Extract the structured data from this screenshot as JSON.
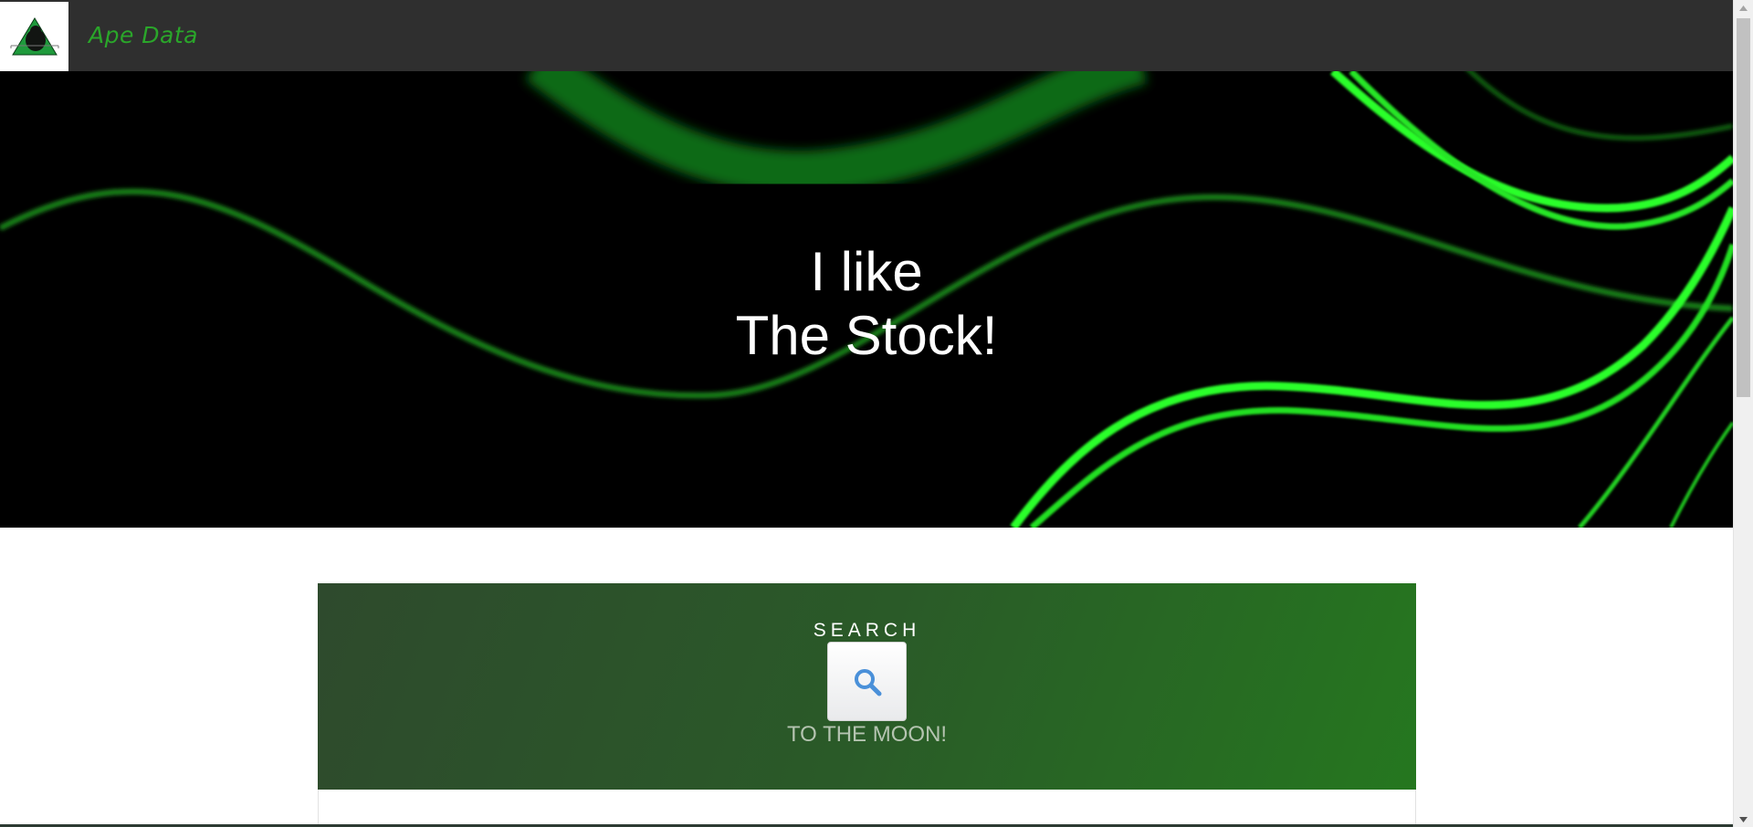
{
  "navbar": {
    "brand": "Ape Data",
    "logo_icon": "ape-pyramid-logo-icon"
  },
  "hero": {
    "line1": "I like",
    "line2": "The Stock!"
  },
  "search": {
    "label": "SEARCH",
    "button_icon": "search-icon",
    "tagline": "TO THE MOON!"
  },
  "colors": {
    "navbar_bg": "#2f2f2f",
    "brand_green": "#2aa62a",
    "hero_bg": "#000000",
    "line_green": "#2bff2b",
    "panel_green_start": "#2e4a2d",
    "panel_green_end": "#25771f",
    "search_icon_blue": "#4a90d9"
  }
}
